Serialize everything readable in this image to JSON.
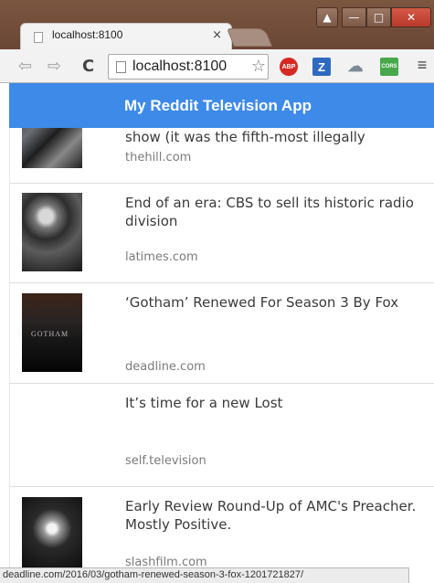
{
  "browser": {
    "tab_title": "localhost:8100",
    "tab_close": "×",
    "url_display": "localhost:8100",
    "window_buttons": {
      "user": "▲",
      "minimize": "—",
      "maximize": "□",
      "close": "✕"
    },
    "nav": {
      "back": "⇦",
      "forward": "⇨",
      "reload": "C"
    },
    "star": "☆",
    "extensions": {
      "abp": "ABP",
      "z": "Z",
      "cloud": "☁",
      "cors": "CORS",
      "menu": "≡"
    }
  },
  "app": {
    "title": "My Reddit Television App",
    "posts": [
      {
        "title": "show (it was the fifth-most illegally",
        "domain": "thehill.com"
      },
      {
        "title": "End of an era: CBS to sell its historic radio division",
        "domain": "latimes.com"
      },
      {
        "title": "‘Gotham’ Renewed For Season 3 By Fox",
        "domain": "deadline.com",
        "thumb_text": "GOTHAM"
      },
      {
        "title": "It’s time for a new Lost",
        "domain": "self.television"
      },
      {
        "title": "Early Review Round-Up of AMC's Preacher. Mostly Positive.",
        "domain": "slashfilm.com"
      }
    ]
  },
  "status_bar": "deadline.com/2016/03/gotham-renewed-season-3-fox-1201721827/",
  "icons": [
    "page-icon",
    "back-arrow-icon",
    "forward-arrow-icon",
    "reload-icon",
    "star-icon",
    "adblock-icon",
    "z-extension-icon",
    "cloud-icon",
    "cors-icon",
    "menu-icon"
  ],
  "colors": {
    "header": "#3d8ae8",
    "chrome": "#6b4a38",
    "toolbar": "#f2f2f2",
    "text": "#3a3a3a",
    "domain": "#7b7b7b"
  }
}
